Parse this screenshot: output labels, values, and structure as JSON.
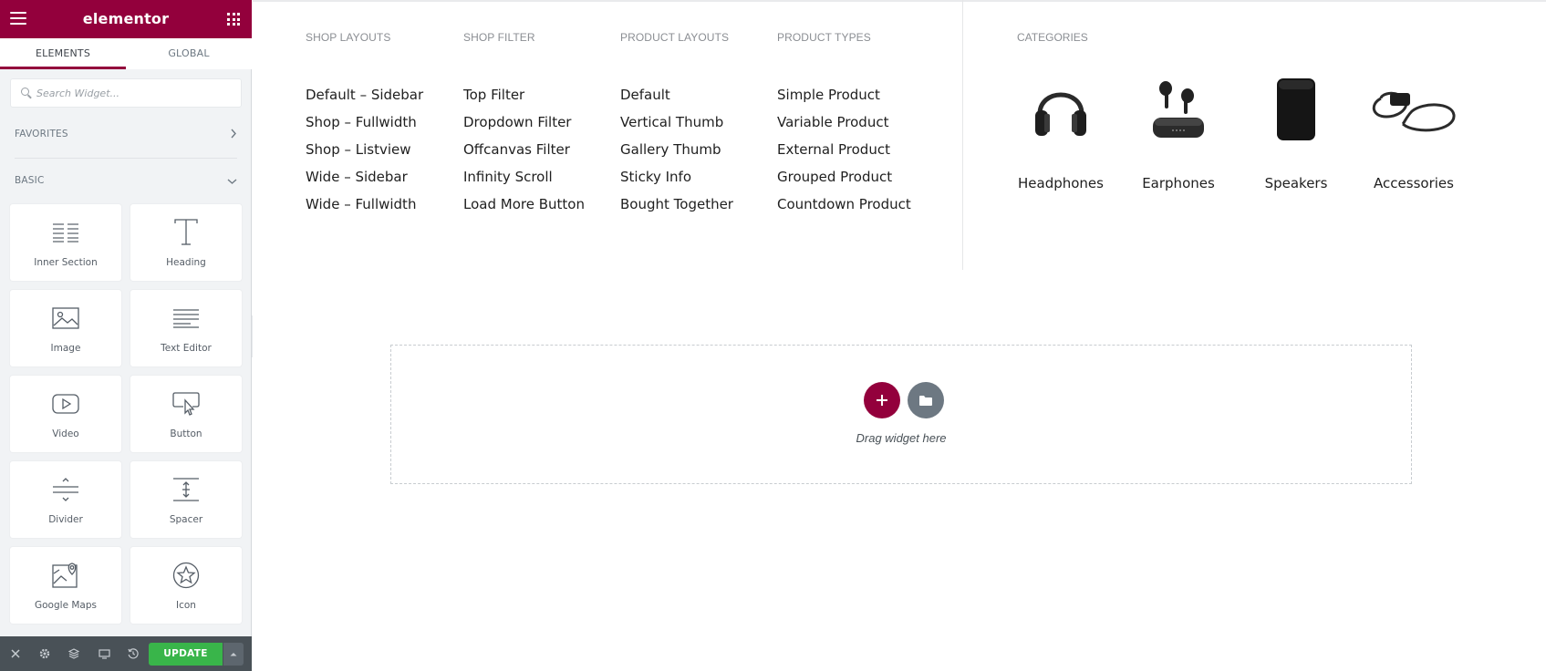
{
  "panel": {
    "brand": "elementor",
    "tabs": [
      {
        "label": "ELEMENTS"
      },
      {
        "label": "GLOBAL"
      }
    ],
    "search_placeholder": "Search Widget...",
    "sections": {
      "favorites": "FAVORITES",
      "basic": "BASIC"
    },
    "widgets": [
      {
        "label": "Inner Section",
        "icon": "inner-section-icon"
      },
      {
        "label": "Heading",
        "icon": "heading-icon"
      },
      {
        "label": "Image",
        "icon": "image-icon"
      },
      {
        "label": "Text Editor",
        "icon": "text-editor-icon"
      },
      {
        "label": "Video",
        "icon": "video-icon"
      },
      {
        "label": "Button",
        "icon": "button-icon"
      },
      {
        "label": "Divider",
        "icon": "divider-icon"
      },
      {
        "label": "Spacer",
        "icon": "spacer-icon"
      },
      {
        "label": "Google Maps",
        "icon": "google-maps-icon"
      },
      {
        "label": "Icon",
        "icon": "icon-widget-icon"
      }
    ],
    "footer": {
      "update_label": "UPDATE"
    },
    "colors": {
      "brand": "#93003c",
      "update": "#39b54a",
      "footer": "#495157"
    }
  },
  "menu": {
    "columns": [
      {
        "title": "SHOP LAYOUTS",
        "links": [
          "Default – Sidebar",
          "Shop – Fullwidth",
          "Shop – Listview",
          "Wide – Sidebar",
          "Wide – Fullwidth"
        ]
      },
      {
        "title": "SHOP FILTER",
        "links": [
          "Top Filter",
          "Dropdown Filter",
          "Offcanvas Filter",
          "Infinity Scroll",
          "Load More Button"
        ]
      },
      {
        "title": "PRODUCT LAYOUTS",
        "links": [
          "Default",
          "Vertical Thumb",
          "Gallery Thumb",
          "Sticky Info",
          "Bought Together"
        ]
      },
      {
        "title": "PRODUCT TYPES",
        "links": [
          "Simple Product",
          "Variable Product",
          "External Product",
          "Grouped Product",
          "Countdown Product"
        ]
      }
    ],
    "categories": {
      "title": "CATEGORIES",
      "items": [
        {
          "name": "Headphones",
          "icon": "headphones-image"
        },
        {
          "name": "Earphones",
          "icon": "earphones-image"
        },
        {
          "name": "Speakers",
          "icon": "speaker-image"
        },
        {
          "name": "Accessories",
          "icon": "cable-image"
        }
      ]
    }
  },
  "dropzone": {
    "text": "Drag widget here"
  }
}
